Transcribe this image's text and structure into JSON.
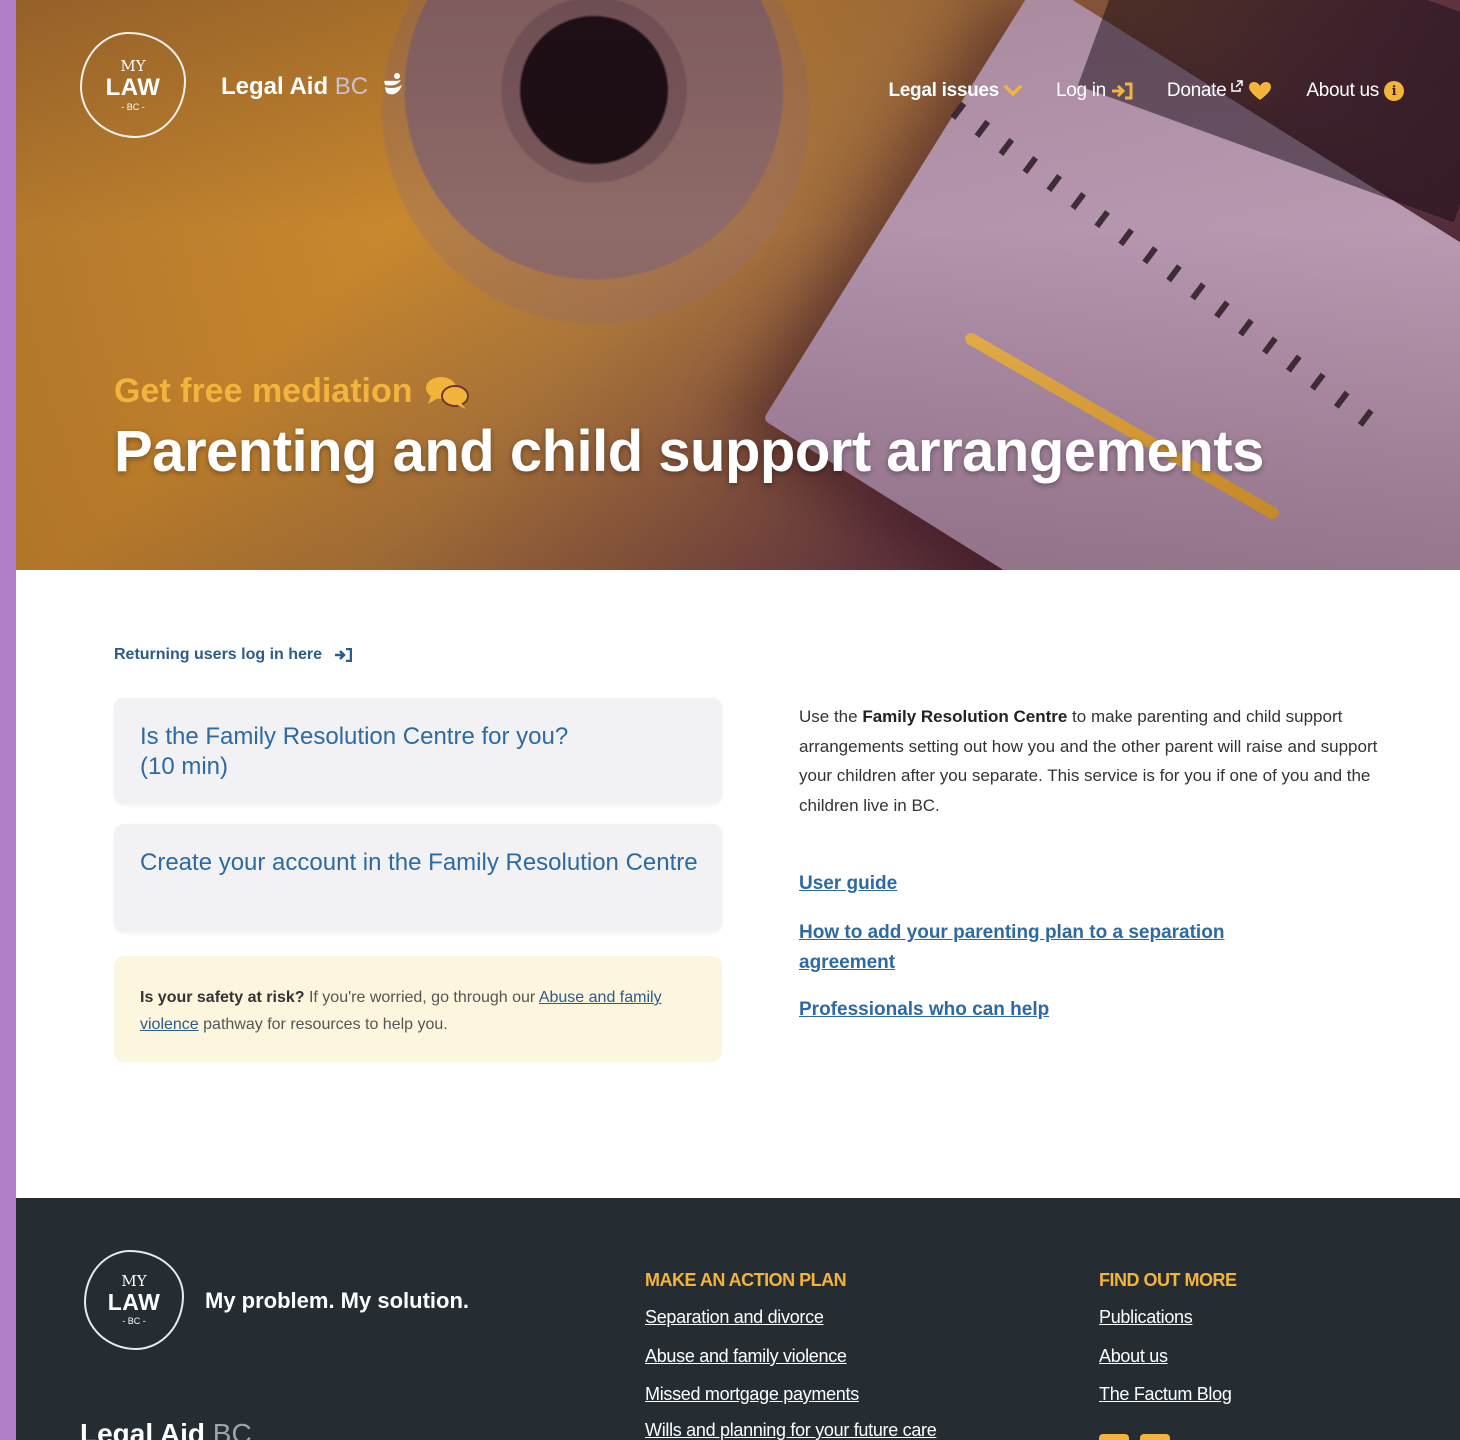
{
  "header": {
    "logo": {
      "my": "MY",
      "law": "LAW",
      "bc": "- BC -"
    },
    "partner": {
      "name": "Legal Aid",
      "suffix": "BC"
    },
    "nav": [
      {
        "label": "Legal issues",
        "icon": "chevron-down-icon"
      },
      {
        "label": "Log in",
        "icon": "sign-in-icon"
      },
      {
        "label": "Donate",
        "icon": "heart-icon"
      },
      {
        "label": "About us",
        "icon": "info-icon"
      }
    ]
  },
  "hero": {
    "eyebrow": "Get free mediation",
    "title": "Parenting and child support arrangements"
  },
  "main": {
    "returning_label": "Returning users log in here",
    "cards": [
      {
        "label": "Is the Family Resolution Centre for you? (10 min)"
      },
      {
        "label": "Create your account in the Family Resolution Centre"
      }
    ],
    "safety": {
      "lead": "Is your safety at risk?",
      "text_before": "If you're worried, go through our",
      "link": "Abuse and family violence",
      "text_after": "pathway for resources to help you."
    },
    "description": {
      "prefix": "Use the",
      "bold": "Family Resolution Centre",
      "rest": "to make parenting and child support arrangements setting out how you and the other parent will raise and support your children after you separate. This service is for you if one of you and the children live in BC."
    },
    "links": [
      "User guide",
      "How to add your parenting plan to a separation agreement",
      "Professionals who can help"
    ]
  },
  "footer": {
    "logo": {
      "my": "MY",
      "law": "LAW",
      "bc": "- BC -"
    },
    "tagline": "My problem. My solution.",
    "partner": {
      "name": "Legal Aid",
      "suffix": "BC"
    },
    "col1": {
      "heading": "MAKE AN ACTION PLAN",
      "links": [
        "Separation and divorce",
        "Abuse and family violence",
        "Missed mortgage payments",
        "Wills and planning for your future care"
      ]
    },
    "col2": {
      "heading": "FIND OUT MORE",
      "links": [
        "Publications",
        "About us",
        "The Factum Blog"
      ]
    }
  },
  "colors": {
    "accent": "#f3b43c",
    "link": "#2d6aa3",
    "footer_bg": "#252d33",
    "sidebar": "#b07fc8"
  }
}
